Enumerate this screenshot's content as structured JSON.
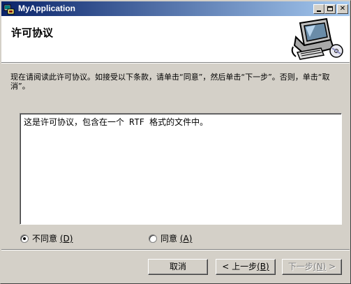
{
  "window": {
    "title": "MyApplication",
    "icon": "installer-app-icon"
  },
  "banner": {
    "title": "许可协议",
    "icon": "computer-setup-icon"
  },
  "instruction": "现在请阅读此许可协议。如接受以下条款，请单击“同意”，然后单击“下一步”。否则，单击“取消”。",
  "license_text": "这是许可协议，包含在一个 RTF 格式的文件中。",
  "radios": {
    "disagree_label": "不同意",
    "disagree_key": "(D)",
    "agree_label": "同意",
    "agree_key": "(A)",
    "selected": "disagree"
  },
  "buttons": {
    "cancel": "取消",
    "back_label": "< 上一步",
    "back_key": "(B)",
    "next_label": "下一步",
    "next_key": "(N)",
    "next_suffix": " >"
  }
}
